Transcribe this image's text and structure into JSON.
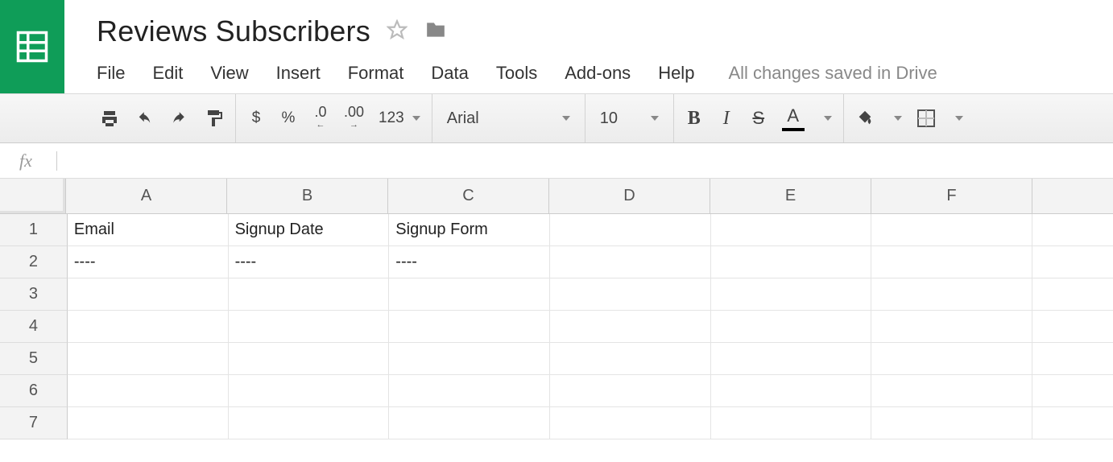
{
  "header": {
    "title": "Reviews Subscribers",
    "save_status": "All changes saved in Drive"
  },
  "menu": {
    "file": "File",
    "edit": "Edit",
    "view": "View",
    "insert": "Insert",
    "format": "Format",
    "data": "Data",
    "tools": "Tools",
    "addons": "Add-ons",
    "help": "Help"
  },
  "toolbar": {
    "currency": "$",
    "percent": "%",
    "decrease_decimal": ".0",
    "increase_decimal": ".00",
    "number_format": "123",
    "font_name": "Arial",
    "font_size": "10",
    "bold": "B",
    "italic": "I",
    "strike": "S",
    "text_color_letter": "A"
  },
  "formula_bar": {
    "fx": "fx",
    "value": ""
  },
  "sheet": {
    "columns": [
      "A",
      "B",
      "C",
      "D",
      "E",
      "F"
    ],
    "rows": [
      "1",
      "2",
      "3",
      "4",
      "5",
      "6",
      "7"
    ],
    "cells": {
      "r1": {
        "A": "Email",
        "B": "Signup Date",
        "C": "Signup Form",
        "D": "",
        "E": "",
        "F": ""
      },
      "r2": {
        "A": "----",
        "B": "----",
        "C": "----",
        "D": "",
        "E": "",
        "F": ""
      },
      "r3": {
        "A": "",
        "B": "",
        "C": "",
        "D": "",
        "E": "",
        "F": ""
      },
      "r4": {
        "A": "",
        "B": "",
        "C": "",
        "D": "",
        "E": "",
        "F": ""
      },
      "r5": {
        "A": "",
        "B": "",
        "C": "",
        "D": "",
        "E": "",
        "F": ""
      },
      "r6": {
        "A": "",
        "B": "",
        "C": "",
        "D": "",
        "E": "",
        "F": ""
      },
      "r7": {
        "A": "",
        "B": "",
        "C": "",
        "D": "",
        "E": "",
        "F": ""
      }
    }
  }
}
